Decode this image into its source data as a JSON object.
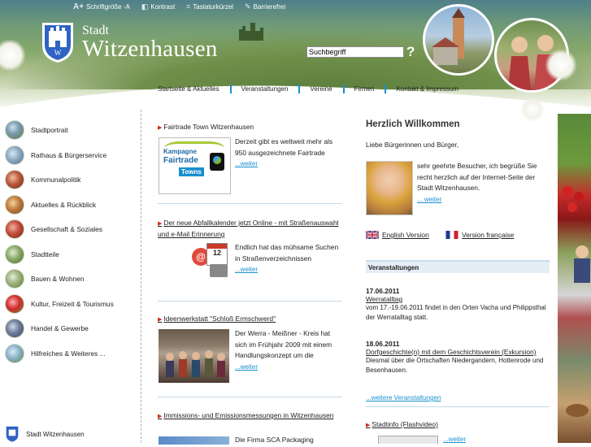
{
  "util": {
    "font_size": "Schriftgröße -A",
    "font_size_plus": "A+",
    "contrast": "Kontrast",
    "shortcuts": "Tastaturkürzel",
    "accessible": "Barrierefrei"
  },
  "brand": {
    "small": "Stadt",
    "big": "Witzenhausen"
  },
  "search": {
    "value": "Suchbegriff",
    "go": "?"
  },
  "nav": [
    "Startseite & Aktuelles",
    "Veranstaltungen",
    "Vereine",
    "Firmen",
    "Kontakt & Impressum"
  ],
  "sidebar": {
    "items": [
      "Stadtportrait",
      "Rathaus & Bürgerservice",
      "Kommunalpolitik",
      "Aktuelles & Rückblick",
      "Gesellschaft & Soziales",
      "Stadtteile",
      "Bauen & Wohnen",
      "Kultur, Freizeit & Tourismus",
      "Handel & Gewerbe",
      "Hilfreiches & Weiteres ..."
    ],
    "footer": "Stadt Witzenhausen"
  },
  "news": [
    {
      "title": "Fairtrade Town Witzenhausen",
      "body": "Derzeit gibt es weltweit mehr als 950 ausgezeichnete Fairtrade",
      "more": "...weiter",
      "img": {
        "line1": "Kampagne",
        "line2": "Fairtrade",
        "line3": "Towns"
      }
    },
    {
      "title": "Der neue Abfallkalender jetzt Online - mit Straßenauswahl und e-Mail Erinnerung",
      "body": "Endlich hat das mühsame Suchen in Straßenverzeichnissen",
      "more": "...weiter",
      "img": {
        "badge": "12"
      }
    },
    {
      "title": "Ideenwerkstatt \"Schloß Ermschwerd\"",
      "body": "Der Werra - Meißner - Kreis hat sich im Frühjahr 2009 mit einem Handlungskonzept um die",
      "more": "...weiter"
    },
    {
      "title": "Immissions- und Emissionsmessungen in Witzenhausen",
      "body": "Die Firma SCA Packaging"
    }
  ],
  "welcome": {
    "heading": "Herzlich Willkommen",
    "salutation": "Liebe Bürgerinnen und Bürger,",
    "text": "sehr geehrte Besucher, ich begrüße Sie recht herzlich auf der Internet-Seite der Stadt Witzenhausen.",
    "more": "... weiter",
    "english": "English Version",
    "french": "Version française"
  },
  "events": {
    "heading": "Veranstaltungen",
    "items": [
      {
        "date": "17.06.2011",
        "title": "Werratalltag",
        "body": "vom 17.-19.06.2011 findet in den Orten Vacha und Philippsthal der Werratalltag statt."
      },
      {
        "date": "18.06.2011",
        "title": "Dorfgeschichte(n) mit dem Geschichtsverein (Exkursion)",
        "body": "Diesmal über die Ortschaften Niedergandern, Hottenrode und Besenhausen."
      }
    ],
    "more": "...weitere Veranstaltungen",
    "video": "Stadtinfo (Flashvideo)",
    "video_more": "...weiter"
  },
  "colors": {
    "accent": "#1a8fd0",
    "nav_separator": "#1a8fd0",
    "arrow": "#c8301c"
  }
}
